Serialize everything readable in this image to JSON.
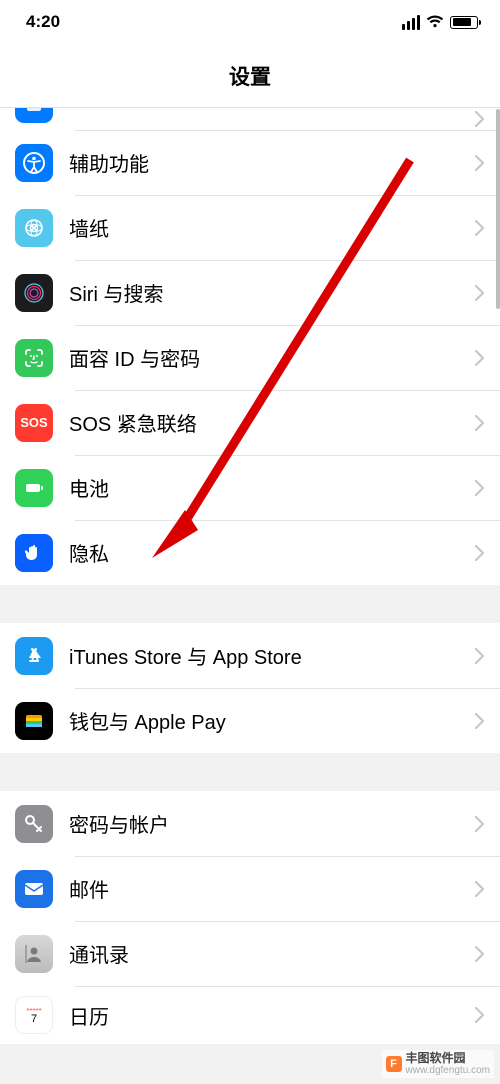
{
  "status": {
    "time": "4:20"
  },
  "title": "设置",
  "groups": [
    {
      "rows": [
        {
          "id": "display-stub",
          "label": "",
          "icon": "display-icon"
        },
        {
          "id": "accessibility",
          "label": "辅助功能",
          "icon": "accessibility-icon"
        },
        {
          "id": "wallpaper",
          "label": "墙纸",
          "icon": "wallpaper-icon"
        },
        {
          "id": "siri",
          "label": "Siri 与搜索",
          "icon": "siri-icon"
        },
        {
          "id": "faceid",
          "label": "面容 ID 与密码",
          "icon": "faceid-icon"
        },
        {
          "id": "sos",
          "label": "SOS 紧急联络",
          "icon": "sos-icon",
          "icon_text": "SOS"
        },
        {
          "id": "battery",
          "label": "电池",
          "icon": "battery-icon"
        },
        {
          "id": "privacy",
          "label": "隐私",
          "icon": "privacy-icon"
        }
      ]
    },
    {
      "rows": [
        {
          "id": "itunes",
          "label": "iTunes Store 与 App Store",
          "icon": "appstore-icon"
        },
        {
          "id": "wallet",
          "label": "钱包与 Apple Pay",
          "icon": "wallet-icon"
        }
      ]
    },
    {
      "rows": [
        {
          "id": "passwords",
          "label": "密码与帐户",
          "icon": "key-icon"
        },
        {
          "id": "mail",
          "label": "邮件",
          "icon": "mail-icon"
        },
        {
          "id": "contacts",
          "label": "通讯录",
          "icon": "contacts-icon"
        },
        {
          "id": "calendar",
          "label": "日历",
          "icon": "calendar-icon"
        }
      ]
    }
  ],
  "watermark": {
    "name": "丰图软件园",
    "url": "www.dgfengtu.com",
    "logo_letter": "F"
  }
}
